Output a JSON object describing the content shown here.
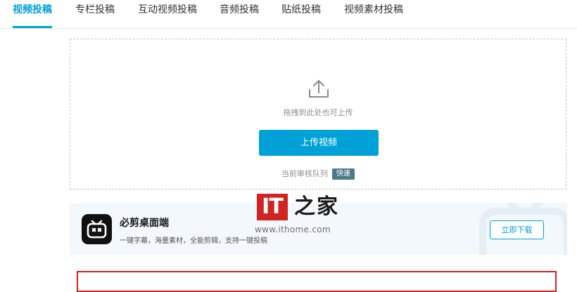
{
  "tabs": [
    {
      "label": "视频投稿",
      "active": true
    },
    {
      "label": "专栏投稿",
      "active": false
    },
    {
      "label": "互动视频投稿",
      "active": false
    },
    {
      "label": "音频投稿",
      "active": false
    },
    {
      "label": "贴纸投稿",
      "active": false
    },
    {
      "label": "视频素材投稿",
      "active": false
    }
  ],
  "upload": {
    "icon": "upload-icon",
    "drop_hint": "拖拽到此处也可上传",
    "button_label": "上传视频",
    "queue_label": "当前审核队列",
    "queue_status": "快速"
  },
  "watermark": {
    "logo_text": "IT",
    "chars": "之家",
    "url": "www.ithome.com"
  },
  "promo": {
    "app_icon": "bijian-tv-icon",
    "title": "必剪桌面端",
    "description": "一键字幕，海量素材，全能剪辑，支持一键投稿",
    "button_label": "立即下载"
  },
  "colors": {
    "accent": "#00a1d6",
    "badge": "#4b7a8a",
    "highlight_border": "#d81e1e"
  }
}
